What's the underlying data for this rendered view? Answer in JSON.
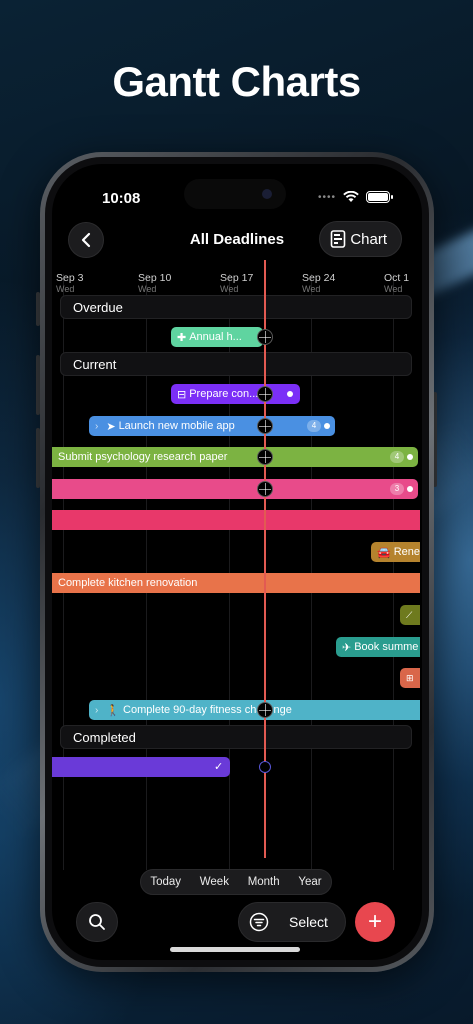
{
  "headline": "Gantt Charts",
  "status": {
    "time": "10:08"
  },
  "nav": {
    "title": "All Deadlines",
    "chart_label": "Chart"
  },
  "dates": [
    {
      "label": "Sep 3",
      "day": "Wed"
    },
    {
      "label": "Sep 10",
      "day": "Wed"
    },
    {
      "label": "Sep 17",
      "day": "Wed"
    },
    {
      "label": "Sep 24",
      "day": "Wed"
    },
    {
      "label": "Oct 1",
      "day": "Wed"
    }
  ],
  "sections": {
    "overdue": "Overdue",
    "current": "Current",
    "completed": "Completed"
  },
  "tasks": [
    {
      "label": "Annual h...",
      "icon": "medical-cross-icon",
      "color": "#5fd4a0"
    },
    {
      "label": "Prepare con...",
      "icon": "presentation-icon",
      "color": "#7b2ff7"
    },
    {
      "label": "Launch new mobile app",
      "icon": "paper-plane-icon",
      "color": "#4a90e2",
      "count": "4"
    },
    {
      "label": "Submit psychology research paper",
      "icon": "",
      "color": "#7cb342",
      "count": "4"
    },
    {
      "label": "",
      "icon": "",
      "color": "#e84b8a",
      "count": "3"
    },
    {
      "label": "",
      "icon": "",
      "color": "#e8386a"
    },
    {
      "label": "Rene",
      "icon": "car-icon",
      "color": "#b5832e"
    },
    {
      "label": "Complete kitchen renovation",
      "icon": "",
      "color": "#e8734a"
    },
    {
      "label": "",
      "icon": "chart-icon",
      "color": "#6e7a1e"
    },
    {
      "label": "Book summe",
      "icon": "airplane-icon",
      "color": "#2a9d8f"
    },
    {
      "label": "",
      "icon": "gift-icon",
      "color": "#d9664a"
    },
    {
      "label": "Complete 90-day fitness challenge",
      "icon": "walking-icon",
      "color": "#4fb3c8"
    },
    {
      "label": "",
      "icon": "",
      "color": "#6a3ad8",
      "done": "✓"
    }
  ],
  "timescale": [
    "Today",
    "Week",
    "Month",
    "Year"
  ],
  "toolbar": {
    "select_label": "Select",
    "add_label": "+"
  },
  "colors": {
    "today_line": "#e25a52",
    "add_button": "#e8474f"
  }
}
